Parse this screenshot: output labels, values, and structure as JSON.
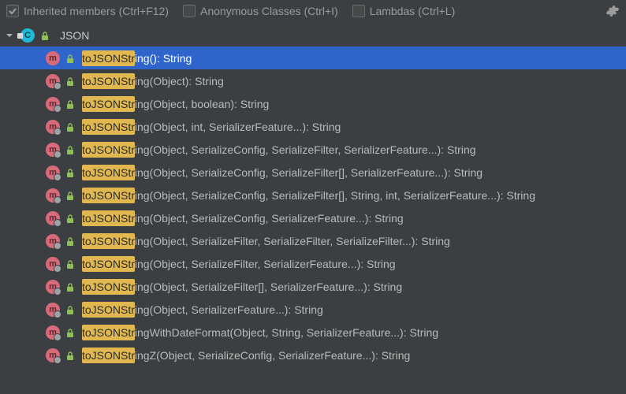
{
  "toolbar": {
    "inherited": {
      "label": "Inherited members (Ctrl+F12)",
      "checked": true
    },
    "anonymous": {
      "label": "Anonymous Classes (Ctrl+I)",
      "checked": false
    },
    "lambdas": {
      "label": "Lambdas (Ctrl+L)",
      "checked": false
    }
  },
  "class_row": {
    "icon_letter": "C",
    "name": "JSON"
  },
  "search_highlight": "toJSONStr",
  "methods": [
    {
      "highlight": "toJSONStr",
      "rest": "ing(): String",
      "inherited": false,
      "selected": true
    },
    {
      "highlight": "toJSONStr",
      "rest": "ing(Object): String",
      "inherited": true,
      "selected": false
    },
    {
      "highlight": "toJSONStr",
      "rest": "ing(Object, boolean): String",
      "inherited": true,
      "selected": false
    },
    {
      "highlight": "toJSONStr",
      "rest": "ing(Object, int, SerializerFeature...): String",
      "inherited": true,
      "selected": false
    },
    {
      "highlight": "toJSONStr",
      "rest": "ing(Object, SerializeConfig, SerializeFilter, SerializerFeature...): String",
      "inherited": true,
      "selected": false
    },
    {
      "highlight": "toJSONStr",
      "rest": "ing(Object, SerializeConfig, SerializeFilter[], SerializerFeature...): String",
      "inherited": true,
      "selected": false
    },
    {
      "highlight": "toJSONStr",
      "rest": "ing(Object, SerializeConfig, SerializeFilter[], String, int, SerializerFeature...): String",
      "inherited": true,
      "selected": false
    },
    {
      "highlight": "toJSONStr",
      "rest": "ing(Object, SerializeConfig, SerializerFeature...): String",
      "inherited": true,
      "selected": false
    },
    {
      "highlight": "toJSONStr",
      "rest": "ing(Object, SerializeFilter, SerializeFilter, SerializeFilter...): String",
      "inherited": true,
      "selected": false
    },
    {
      "highlight": "toJSONStr",
      "rest": "ing(Object, SerializeFilter, SerializerFeature...): String",
      "inherited": true,
      "selected": false
    },
    {
      "highlight": "toJSONStr",
      "rest": "ing(Object, SerializeFilter[], SerializerFeature...): String",
      "inherited": true,
      "selected": false
    },
    {
      "highlight": "toJSONStr",
      "rest": "ing(Object, SerializerFeature...): String",
      "inherited": true,
      "selected": false
    },
    {
      "highlight": "toJSONStr",
      "rest": "ingWithDateFormat(Object, String, SerializerFeature...): String",
      "inherited": true,
      "selected": false
    },
    {
      "highlight": "toJSONStr",
      "rest": "ingZ(Object, SerializeConfig, SerializerFeature...): String",
      "inherited": true,
      "selected": false
    }
  ],
  "icons": {
    "method_letter": "m"
  }
}
